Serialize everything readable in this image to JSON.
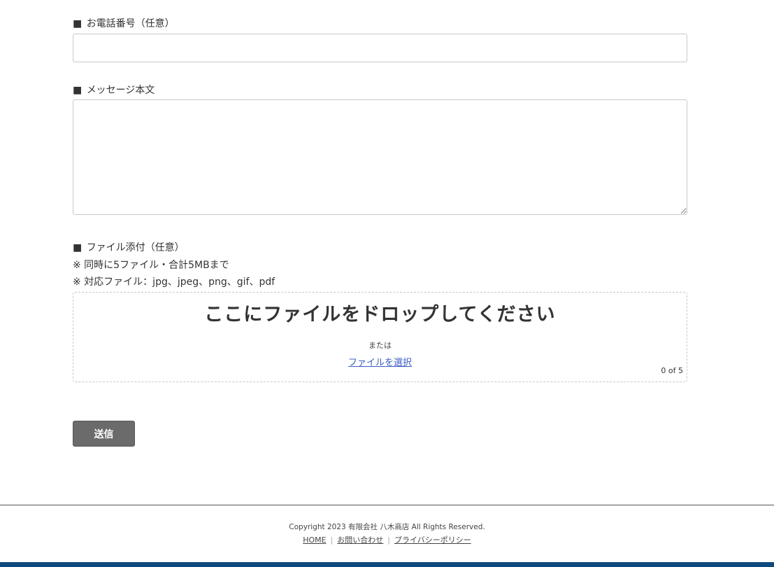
{
  "form": {
    "phone": {
      "label": "お電話番号（任意）",
      "value": "",
      "placeholder": ""
    },
    "message": {
      "label": "メッセージ本文",
      "value": "",
      "placeholder": ""
    },
    "attachment": {
      "label": "ファイル添付（任意）",
      "note1": "※ 同時に5ファイル・合計5MBまで",
      "note2": "※ 対応ファイル：jpg、jpeg、png、gif、pdf",
      "drop_title": "ここにファイルをドロップしてください",
      "or_text": "または",
      "select_link": "ファイルを選択",
      "count": "0 of 5"
    },
    "label_marker": "■",
    "submit_label": "送信"
  },
  "footer": {
    "copyright": "Copyright 2023 有限会社 八木商店 All Rights Reserved.",
    "links": [
      "HOME",
      "お問い合わせ",
      "プライバシーポリシー"
    ],
    "separator": "|"
  },
  "colors": {
    "submit_bg": "#6b6b6b",
    "bottom_bar": "#0f4a7e",
    "link": "#3b5fc4"
  }
}
